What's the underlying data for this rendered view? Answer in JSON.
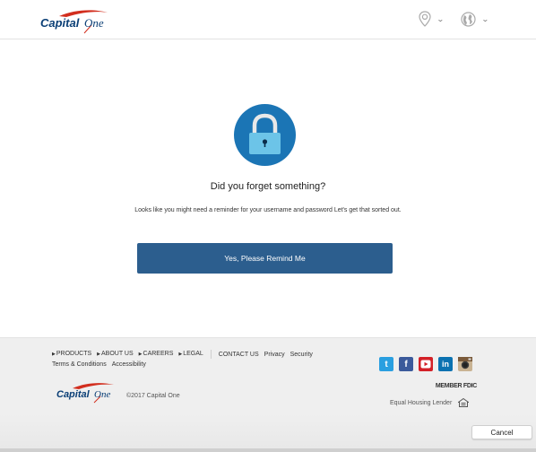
{
  "header": {
    "logo_text_main": "Capital",
    "logo_text_one": "One",
    "location_icon": "location-pin-icon",
    "globe_icon": "globe-icon",
    "caret": "⌄"
  },
  "main": {
    "icon": "padlock-icon",
    "title": "Did you forget something?",
    "description": "Looks like you might need a reminder for your username and password Let's get that sorted out.",
    "primary_button": "Yes, Please Remind Me"
  },
  "footer": {
    "nav_links": [
      {
        "label": "PRODUCTS",
        "arrow": "▶"
      },
      {
        "label": "ABOUT US",
        "arrow": "▶"
      },
      {
        "label": "CAREERS",
        "arrow": "▶"
      },
      {
        "label": "LEGAL",
        "arrow": "▶"
      }
    ],
    "plain_links": [
      "CONTACT US",
      "Privacy",
      "Security"
    ],
    "second_row_links": [
      "Terms & Conditions",
      "Accessibility"
    ],
    "copyright": "©2017 Capital One",
    "social": [
      {
        "name": "twitter",
        "glyph": "t"
      },
      {
        "name": "facebook",
        "glyph": "f"
      },
      {
        "name": "youtube",
        "glyph": "▶"
      },
      {
        "name": "linkedin",
        "glyph": "in"
      },
      {
        "name": "instagram",
        "glyph": "◉"
      }
    ],
    "member_fdic": "MEMBER FDIC",
    "equal_housing": "Equal Housing Lender"
  },
  "dialog": {
    "cancel_button": "Cancel"
  },
  "colors": {
    "brand_navy": "#0b3f76",
    "brand_red": "#d22e1e",
    "primary_button": "#2c5e8e",
    "lock_circle": "#1b75b5",
    "lock_body": "#6cc4e8",
    "footer_bg": "#efefef"
  }
}
